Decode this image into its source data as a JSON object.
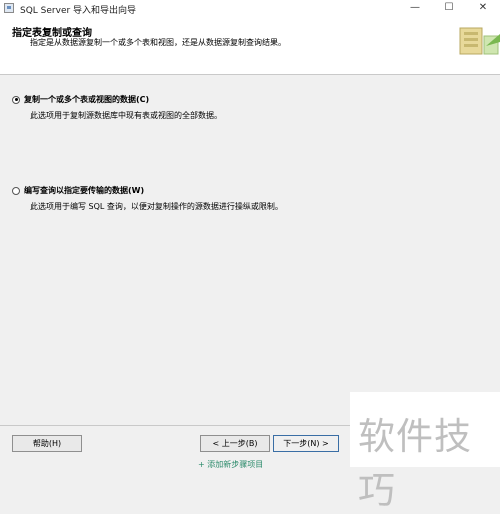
{
  "window": {
    "title": "SQL Server 导入和导出向导",
    "minimize_glyph": "—",
    "maximize_glyph": "☐",
    "close_glyph": "✕"
  },
  "header": {
    "title": "指定表复制或查询",
    "description": "指定是从数据源复制一个或多个表和视图，还是从数据源复制查询结果。"
  },
  "options": [
    {
      "label": "复制一个或多个表或视图的数据(C)",
      "description": "此选项用于复制源数据库中现有表或视图的全部数据。",
      "selected": true
    },
    {
      "label": "编写查询以指定要传输的数据(W)",
      "description": "此选项用于编写 SQL 查询，以便对复制操作的源数据进行操纵或限制。",
      "selected": false
    }
  ],
  "buttons": {
    "help": "帮助(H)",
    "back": "< 上一步(B)",
    "next": "下一步(N) >"
  },
  "watermark": "软件技巧",
  "footer_partial_text": "+ 添加新步骤项目",
  "colors": {
    "background": "#f0f0f0",
    "header_bg": "#ffffff",
    "default_button_border": "#3a6ea5"
  }
}
